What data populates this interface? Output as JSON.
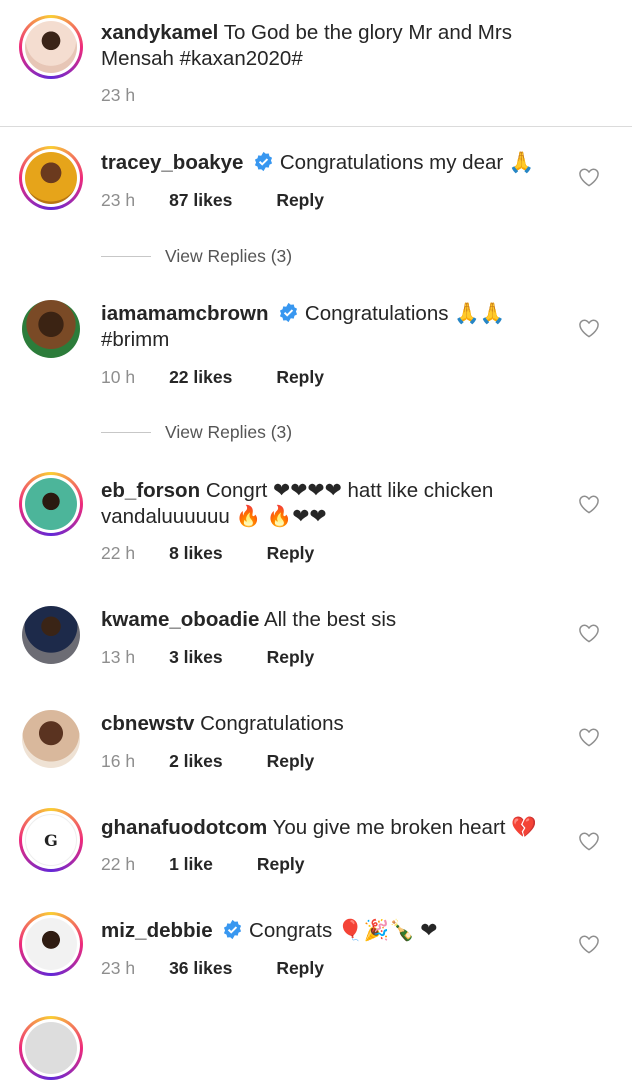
{
  "caption": {
    "username": "xandykamel",
    "text": "To God be the glory  Mr and Mrs Mensah #kaxan2020#",
    "time": "23 h"
  },
  "comments": [
    {
      "username": "tracey_boakye",
      "verified": true,
      "text": "Congratulations my dear 🙏",
      "time": "23 h",
      "likes": "87 likes",
      "reply": "Reply",
      "view_replies": "View Replies (3)"
    },
    {
      "username": "iamamamcbrown",
      "verified": true,
      "text": "Congratulations 🙏🙏 #brimm",
      "time": "10 h",
      "likes": "22 likes",
      "reply": "Reply",
      "view_replies": "View Replies (3)"
    },
    {
      "username": "eb_forson",
      "verified": false,
      "text": "Congrt ❤❤❤❤ hatt like chicken vandaluuuuuu 🔥 🔥❤❤",
      "time": "22 h",
      "likes": "8 likes",
      "reply": "Reply"
    },
    {
      "username": "kwame_oboadie",
      "verified": false,
      "text": "All the best sis",
      "time": "13 h",
      "likes": "3 likes",
      "reply": "Reply"
    },
    {
      "username": "cbnewstv",
      "verified": false,
      "text": "Congratulations",
      "time": "16 h",
      "likes": "2 likes",
      "reply": "Reply"
    },
    {
      "username": "ghanafuodotcom",
      "verified": false,
      "text": "You give me broken heart 💔",
      "time": "22 h",
      "likes": "1 like",
      "reply": "Reply"
    },
    {
      "username": "miz_debbie",
      "verified": true,
      "text": "Congrats 🎈🎉🍾 ❤",
      "time": "23 h",
      "likes": "36 likes",
      "reply": "Reply"
    }
  ],
  "colors": {
    "verified": "#3897f0",
    "story_ring": "#ee2a7b",
    "heart_emoji": "#e0142b"
  },
  "icons": {
    "like": "heart-outline-icon",
    "verified": "verified-badge-icon"
  }
}
